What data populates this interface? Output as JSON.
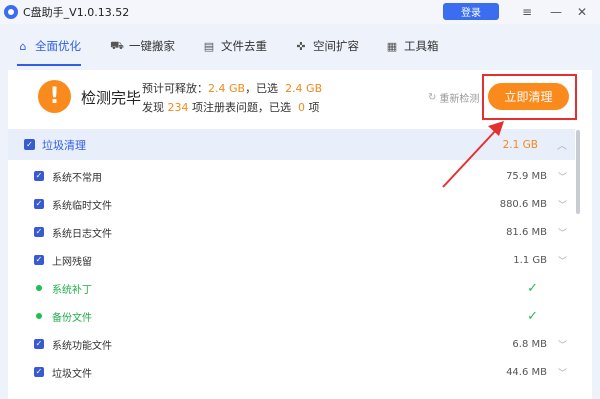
{
  "titlebar": {
    "title": "C盘助手_V1.0.13.52",
    "login_label": "登录",
    "menu_icon": "≡",
    "minimize_icon": "—",
    "close_icon": "✕"
  },
  "tabs": [
    {
      "label": "全面优化",
      "icon": "home-icon",
      "glyph": "⌂",
      "active": true
    },
    {
      "label": "一键搬家",
      "icon": "truck-icon",
      "glyph": "⛟",
      "active": false
    },
    {
      "label": "文件去重",
      "icon": "file-icon",
      "glyph": "▤",
      "active": false
    },
    {
      "label": "空间扩容",
      "icon": "expand-icon",
      "glyph": "✜",
      "active": false
    },
    {
      "label": "工具箱",
      "icon": "toolbox-icon",
      "glyph": "▦",
      "active": false
    }
  ],
  "summary": {
    "status": "检测完毕",
    "warn_glyph": "!",
    "line1_prefix": "预计可释放：",
    "line1_value": "2.4 GB",
    "line1_mid": "，已选",
    "line1_selected": "2.4 GB",
    "line2_prefix": "发现",
    "line2_count": "234",
    "line2_mid": "项注册表问题，已选",
    "line2_selected": "0",
    "line2_suffix": "项",
    "rescan_label": "重新检测",
    "clean_label": "立即清理"
  },
  "list": {
    "group": {
      "label": "垃圾清理",
      "size": "2.1 GB",
      "expanded": true
    },
    "items": [
      {
        "label": "系统不常用",
        "type": "checkbox",
        "size": "75.9 MB"
      },
      {
        "label": "系统临时文件",
        "type": "checkbox",
        "size": "880.6 MB"
      },
      {
        "label": "系统日志文件",
        "type": "checkbox",
        "size": "81.6 MB"
      },
      {
        "label": "上网残留",
        "type": "checkbox",
        "size": "1.1 GB"
      },
      {
        "label": "系统补丁",
        "type": "status",
        "size": ""
      },
      {
        "label": "备份文件",
        "type": "status",
        "size": ""
      },
      {
        "label": "系统功能文件",
        "type": "checkbox",
        "size": "6.8 MB"
      },
      {
        "label": "垃圾文件",
        "type": "checkbox",
        "size": "44.6 MB"
      }
    ]
  },
  "colors": {
    "accent": "#2f5fe8",
    "orange": "#fb8a1c",
    "highlight": "#e53030",
    "ok": "#1fbf4f"
  }
}
